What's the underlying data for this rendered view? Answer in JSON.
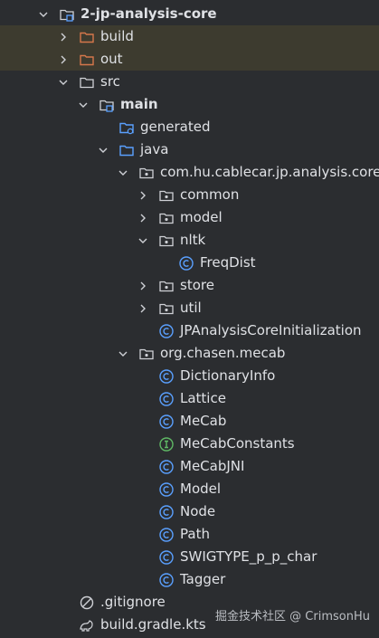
{
  "tree": [
    {
      "label": "2-jp-analysis-core",
      "level": 0,
      "expanded": true,
      "icon": "module-folder-icon",
      "bold": true
    },
    {
      "label": "build",
      "level": 1,
      "expanded": false,
      "icon": "excluded-folder-icon",
      "excluded": true
    },
    {
      "label": "out",
      "level": 1,
      "expanded": false,
      "icon": "excluded-folder-icon",
      "excluded": true
    },
    {
      "label": "src",
      "level": 1,
      "expanded": true,
      "icon": "folder-icon"
    },
    {
      "label": "main",
      "level": 2,
      "expanded": true,
      "icon": "source-root-folder-icon",
      "bold": true
    },
    {
      "label": "generated",
      "level": 3,
      "expanded": null,
      "icon": "generated-sources-folder-icon"
    },
    {
      "label": "java",
      "level": 3,
      "expanded": true,
      "icon": "java-source-folder-icon"
    },
    {
      "label": "com.hu.cablecar.jp.analysis.core",
      "level": 4,
      "expanded": true,
      "icon": "package-icon"
    },
    {
      "label": "common",
      "level": 5,
      "expanded": false,
      "icon": "package-icon"
    },
    {
      "label": "model",
      "level": 5,
      "expanded": false,
      "icon": "package-icon"
    },
    {
      "label": "nltk",
      "level": 5,
      "expanded": true,
      "icon": "package-icon"
    },
    {
      "label": "FreqDist",
      "level": 6,
      "expanded": null,
      "icon": "class-icon"
    },
    {
      "label": "store",
      "level": 5,
      "expanded": false,
      "icon": "package-icon"
    },
    {
      "label": "util",
      "level": 5,
      "expanded": false,
      "icon": "package-icon"
    },
    {
      "label": "JPAnalysisCoreInitialization",
      "level": 5,
      "expanded": null,
      "icon": "class-icon"
    },
    {
      "label": "org.chasen.mecab",
      "level": 4,
      "expanded": true,
      "icon": "package-icon"
    },
    {
      "label": "DictionaryInfo",
      "level": 5,
      "expanded": null,
      "icon": "class-icon"
    },
    {
      "label": "Lattice",
      "level": 5,
      "expanded": null,
      "icon": "class-icon"
    },
    {
      "label": "MeCab",
      "level": 5,
      "expanded": null,
      "icon": "class-icon"
    },
    {
      "label": "MeCabConstants",
      "level": 5,
      "expanded": null,
      "icon": "interface-icon"
    },
    {
      "label": "MeCabJNI",
      "level": 5,
      "expanded": null,
      "icon": "class-icon"
    },
    {
      "label": "Model",
      "level": 5,
      "expanded": null,
      "icon": "class-icon"
    },
    {
      "label": "Node",
      "level": 5,
      "expanded": null,
      "icon": "class-icon"
    },
    {
      "label": "Path",
      "level": 5,
      "expanded": null,
      "icon": "class-icon"
    },
    {
      "label": "SWIGTYPE_p_p_char",
      "level": 5,
      "expanded": null,
      "icon": "class-icon"
    },
    {
      "label": "Tagger",
      "level": 5,
      "expanded": null,
      "icon": "class-icon"
    },
    {
      "label": ".gitignore",
      "level": 1,
      "expanded": null,
      "icon": "gitignore-icon"
    },
    {
      "label": "build.gradle.kts",
      "level": 1,
      "expanded": null,
      "icon": "gradle-icon"
    }
  ],
  "watermark": "掘金技术社区 @ CrimsonHu",
  "colors": {
    "background": "#2b2d30",
    "excluded_row": "#3d3b2f",
    "text": "#dfe1e5",
    "folder_outline": "#cfd1d6",
    "excluded_folder": "#d5774b",
    "source_folder": "#5aa0ff",
    "class": "#5aa0ff",
    "interface": "#5fb865"
  }
}
